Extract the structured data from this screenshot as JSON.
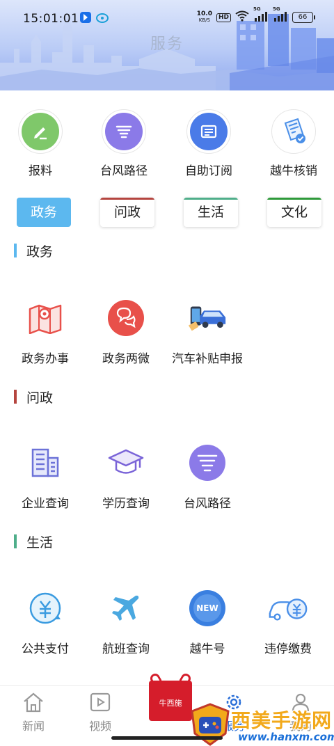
{
  "status_bar": {
    "time": "15:01:01",
    "net_speed_value": "10.0",
    "net_speed_unit": "KB/S",
    "hd_badge": "HD",
    "signal_label_1": "5G",
    "signal_label_2": "5G",
    "battery": "66"
  },
  "header": {
    "title": "服务"
  },
  "quick_actions": [
    {
      "label": "报料",
      "icon": "pen-icon"
    },
    {
      "label": "台风路径",
      "icon": "typhoon-icon"
    },
    {
      "label": "自助订阅",
      "icon": "newspaper-icon"
    },
    {
      "label": "越牛核销",
      "icon": "ticket-icon"
    }
  ],
  "tabs": [
    {
      "label": "政务",
      "active": true,
      "color": "#5cb8ef"
    },
    {
      "label": "问政",
      "active": false,
      "color": "#b5453f"
    },
    {
      "label": "生活",
      "active": false,
      "color": "#4fae8a"
    },
    {
      "label": "文化",
      "active": false,
      "color": "#2e9a3a"
    }
  ],
  "sections": [
    {
      "title": "政务",
      "color": "#5cb8ef",
      "items": [
        {
          "label": "政务办事",
          "icon": "map-pin-icon"
        },
        {
          "label": "政务两微",
          "icon": "chat-bubbles-icon"
        },
        {
          "label": "汽车补贴申报",
          "icon": "car-phone-icon"
        }
      ]
    },
    {
      "title": "问政",
      "color": "#b5453f",
      "items": [
        {
          "label": "企业查询",
          "icon": "building-icon"
        },
        {
          "label": "学历查询",
          "icon": "graduation-cap-icon"
        },
        {
          "label": "台风路径",
          "icon": "typhoon-icon"
        }
      ]
    },
    {
      "title": "生活",
      "color": "#4fae8a",
      "items": [
        {
          "label": "公共支付",
          "icon": "yuan-payment-icon"
        },
        {
          "label": "航班查询",
          "icon": "airplane-icon"
        },
        {
          "label": "越牛号",
          "icon": "new-badge-icon"
        },
        {
          "label": "违停缴费",
          "icon": "car-yuan-icon"
        }
      ]
    }
  ],
  "bottom_nav": {
    "items": [
      {
        "label": "新闻",
        "icon": "house-icon"
      },
      {
        "label": "视频",
        "icon": "play-icon"
      },
      {
        "label": "服务",
        "icon": "gear-icon"
      },
      {
        "label": "我的",
        "icon": "user-icon"
      }
    ],
    "center_logo_text": "牛西施"
  },
  "watermark": {
    "text": "西美手游网",
    "url": "www.hanxm.com"
  },
  "colors": {
    "accent_blue": "#5cb8ef",
    "typhoon_purple": "#8b7ae8",
    "red": "#e8504a",
    "icon_blue": "#4a8fe8"
  }
}
